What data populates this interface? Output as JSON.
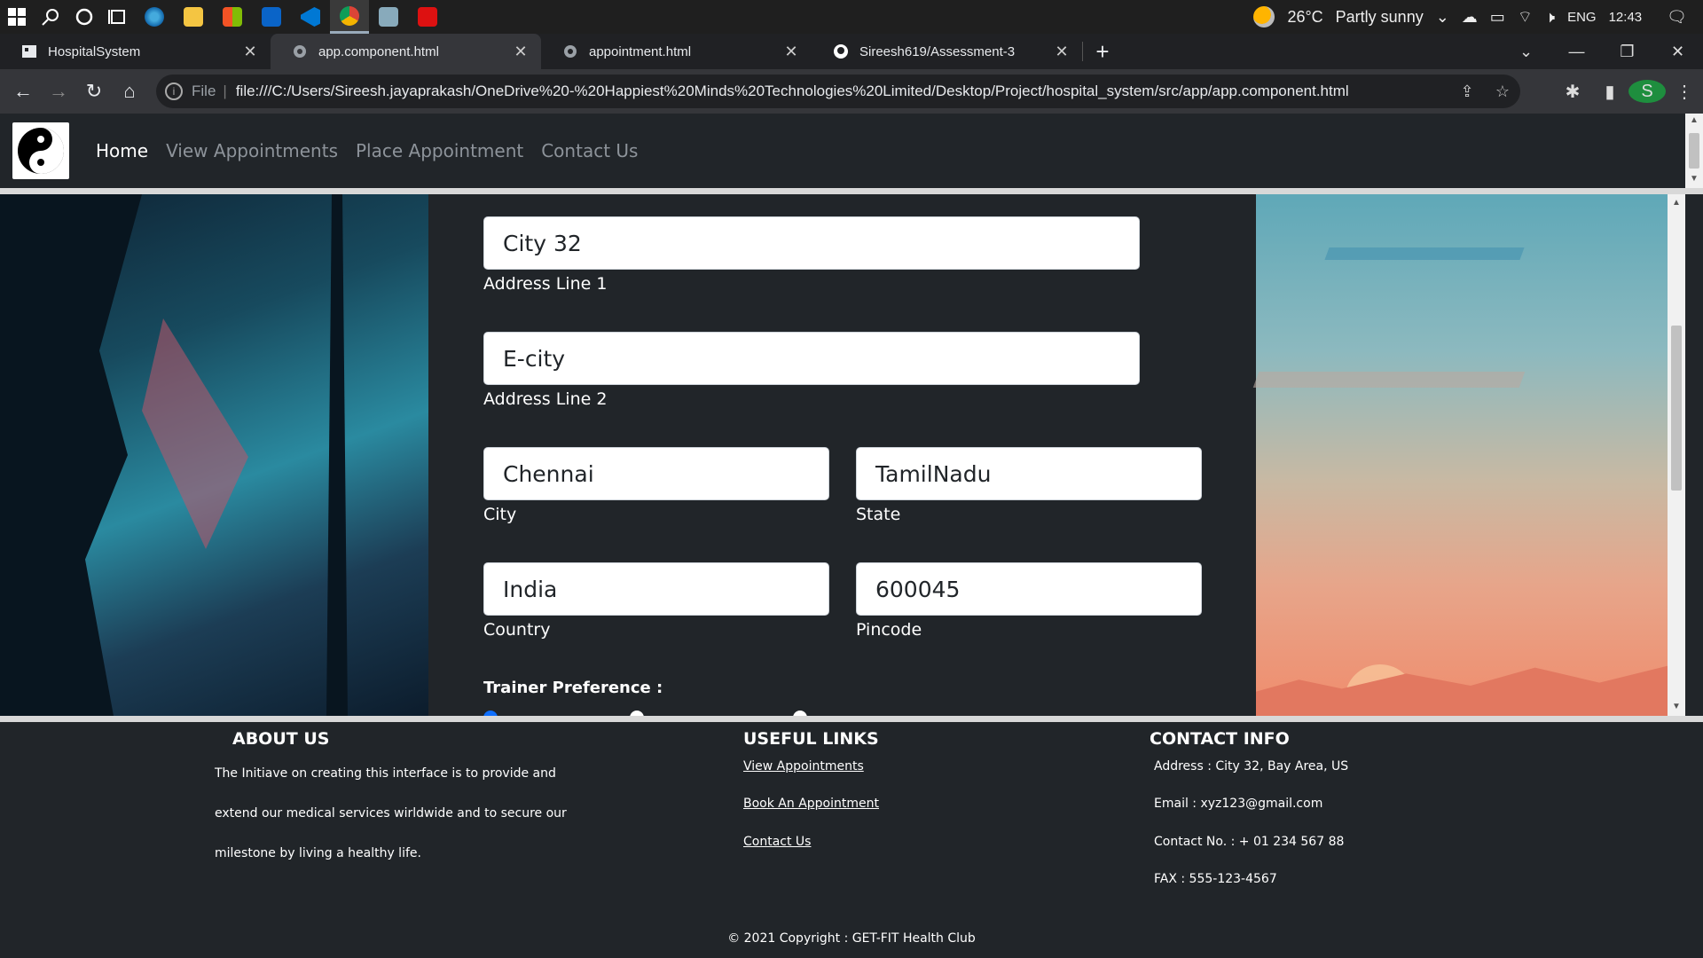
{
  "taskbar": {
    "weather_temp": "26°C",
    "weather_text": "Partly sunny",
    "language": "ENG",
    "time": "12:43"
  },
  "tabs": [
    {
      "title": "HospitalSystem",
      "icon": "document-icon"
    },
    {
      "title": "app.component.html",
      "icon": "globe-icon"
    },
    {
      "title": "appointment.html",
      "icon": "globe-icon"
    },
    {
      "title": "Sireesh619/Assessment-3",
      "icon": "github-icon"
    }
  ],
  "address_bar": {
    "scheme": "File",
    "url": "file:///C:/Users/Sireesh.jayaprakash/OneDrive%20-%20Happiest%20Minds%20Technologies%20Limited/Desktop/Project/hospital_system/src/app/app.component.html"
  },
  "profile_initial": "S",
  "site_nav": {
    "links": [
      "Home",
      "View Appointments",
      "Place Appointment",
      "Contact Us"
    ]
  },
  "form": {
    "address1": {
      "value": "City 32",
      "label": "Address Line 1"
    },
    "address2": {
      "value": "E-city",
      "label": "Address Line 2"
    },
    "city": {
      "value": "Chennai",
      "label": "City"
    },
    "state": {
      "value": "TamilNadu",
      "label": "State"
    },
    "country": {
      "value": "India",
      "label": "Country"
    },
    "pincode": {
      "value": "600045",
      "label": "Pincode"
    },
    "trainer_label": "Trainer Preference :"
  },
  "footer": {
    "about": {
      "heading": "ABOUT US",
      "lines": [
        "The Initiave on creating this interface is to provide and",
        "extend our medical services wirldwide and to secure our",
        "milestone by living a healthy life."
      ]
    },
    "links": {
      "heading": "USEFUL LINKS",
      "items": [
        "View Appointments",
        "Book An Appointment",
        "Contact Us"
      ]
    },
    "contact": {
      "heading": "CONTACT INFO",
      "address": "Address : City 32, Bay Area, US",
      "email": "Email : xyz123@gmail.com",
      "phone": "Contact No. : + 01 234 567 88",
      "fax": "FAX : 555-123-4567"
    },
    "copyright": "© 2021 Copyright : GET-FIT Health Club"
  }
}
